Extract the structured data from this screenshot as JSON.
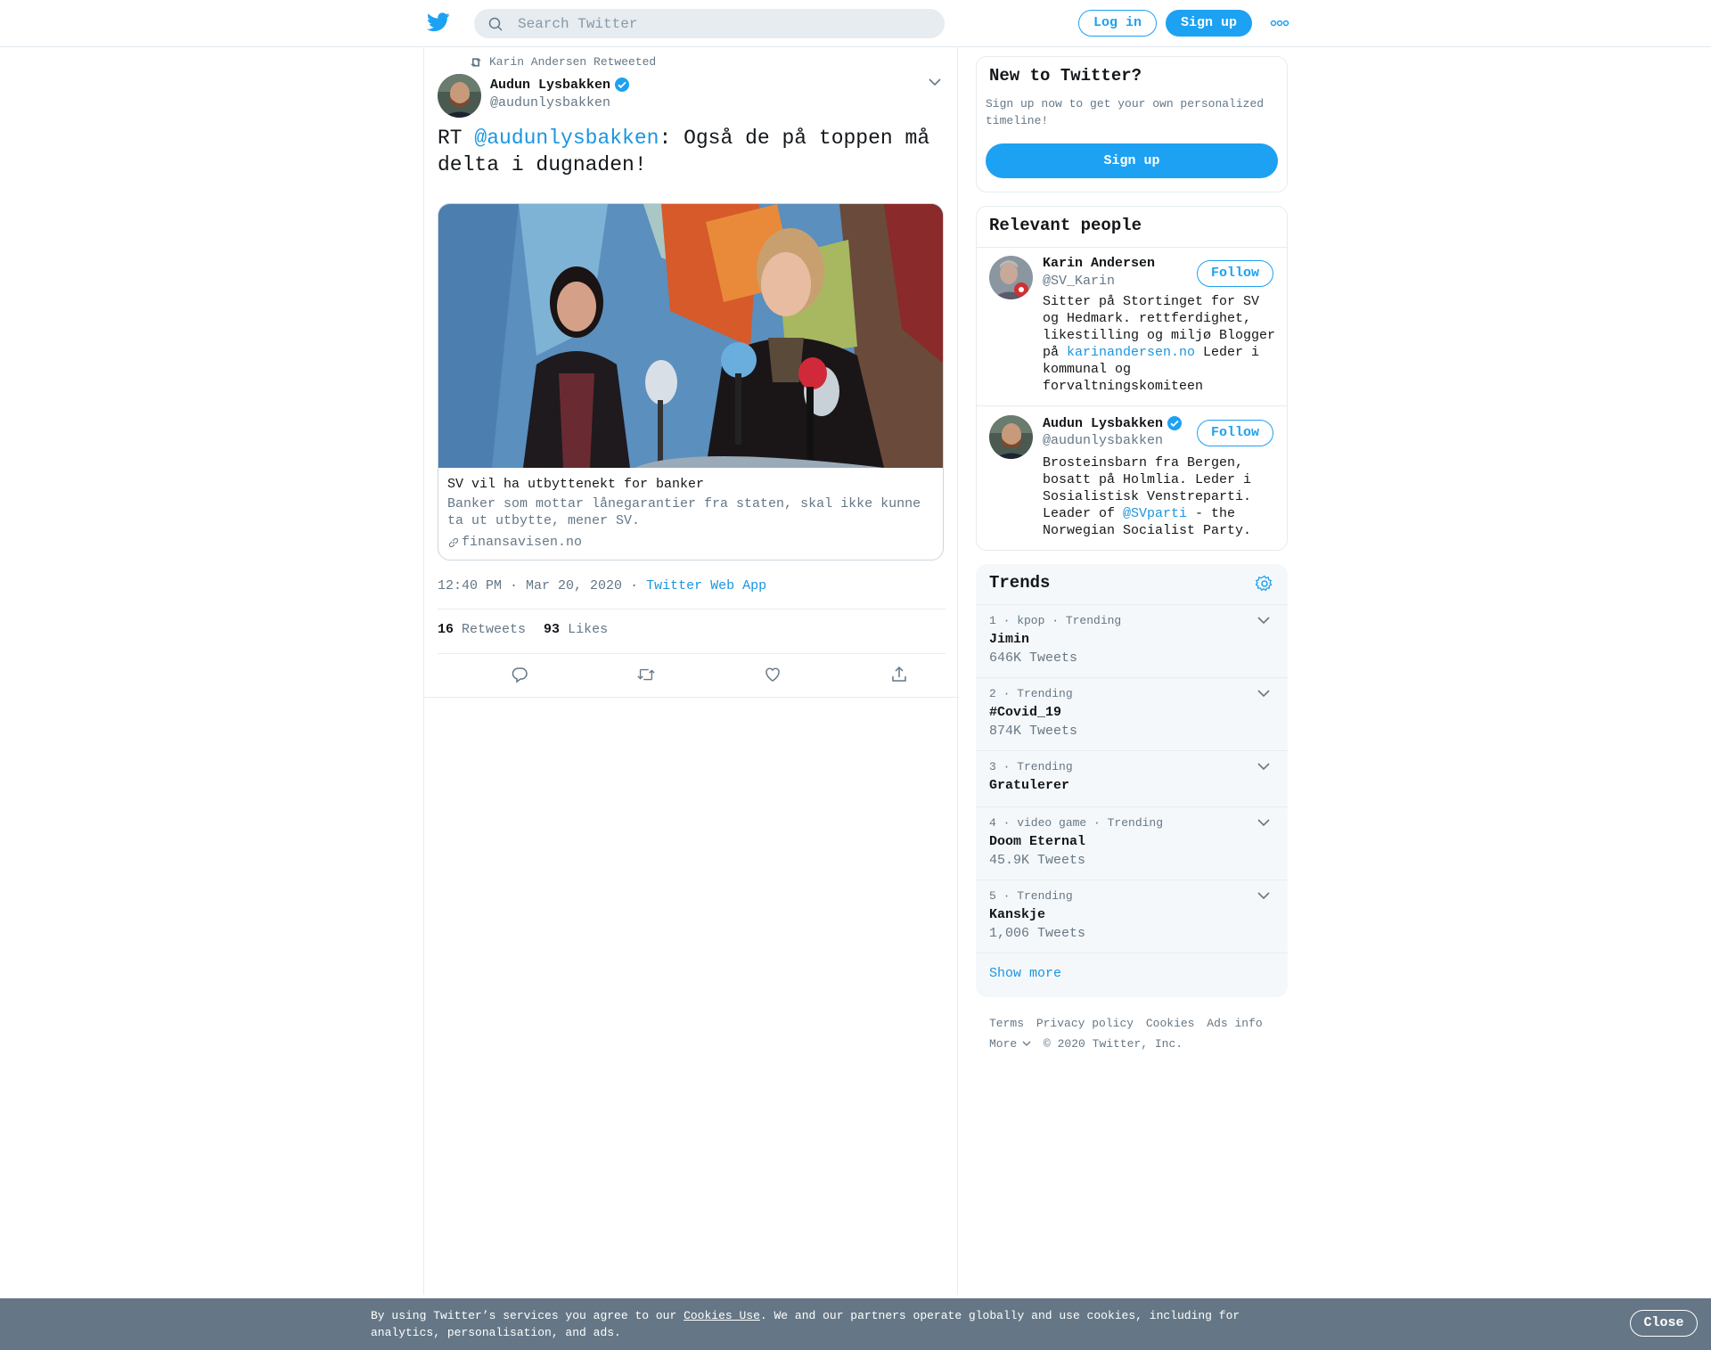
{
  "header": {
    "search_placeholder": "Search Twitter",
    "login_label": "Log in",
    "signup_label": "Sign up"
  },
  "tweet": {
    "retweeted_by": "Karin Andersen Retweeted",
    "author_name": "Audun Lysbakken",
    "author_handle": "@audunlysbakken",
    "text_prefix": "RT ",
    "text_mention": "@audunlysbakken",
    "text_rest": ": Også de på toppen må delta i dugnaden!",
    "card": {
      "title": "SV vil ha utbyttenekt for banker",
      "description": "Banker som mottar lånegarantier fra staten, skal ikke kunne ta ut utbytte, mener SV.",
      "domain": "finansavisen.no"
    },
    "time": "12:40 PM · Mar 20, 2020",
    "separator": "·",
    "source": "Twitter Web App",
    "retweets_count": "16",
    "retweets_label": "Retweets",
    "likes_count": "93",
    "likes_label": "Likes"
  },
  "new_to_twitter": {
    "title": "New to Twitter?",
    "text": "Sign up now to get your own personalized timeline!",
    "button": "Sign up"
  },
  "relevant_people": {
    "title": "Relevant people",
    "people": [
      {
        "name": "Karin Andersen",
        "handle": "@SV_Karin",
        "follow": "Follow",
        "bio_1": "Sitter på Stortinget for SV og Hedmark. rettferdighet, likestilling og miljø Blogger på ",
        "bio_link": "karinandersen.no",
        "bio_2": " Leder i kommunal og forvaltningskomiteen"
      },
      {
        "name": "Audun Lysbakken",
        "handle": "@audunlysbakken",
        "follow": "Follow",
        "bio_1": "Brosteinsbarn fra Bergen, bosatt på Holmlia. Leder i Sosialistisk Venstreparti. Leader of ",
        "bio_link": "@SVparti",
        "bio_2": " - the Norwegian Socialist Party."
      }
    ]
  },
  "trends": {
    "title": "Trends",
    "items": [
      {
        "context": "1 · kpop · Trending",
        "name": "Jimin",
        "count": "646K Tweets"
      },
      {
        "context": "2 · Trending",
        "name": "#Covid_19",
        "count": "874K Tweets"
      },
      {
        "context": "3 · Trending",
        "name": "Gratulerer",
        "count": ""
      },
      {
        "context": "4 · video game · Trending",
        "name": "Doom Eternal",
        "count": "45.9K Tweets"
      },
      {
        "context": "5 · Trending",
        "name": "Kanskje",
        "count": "1,006 Tweets"
      }
    ],
    "show_more": "Show more"
  },
  "footer": {
    "terms": "Terms",
    "privacy": "Privacy policy",
    "cookies": "Cookies",
    "ads": "Ads info",
    "more": "More",
    "copyright": "© 2020 Twitter, Inc."
  },
  "cookie_banner": {
    "text_1": "By using Twitter’s services you agree to our ",
    "link": "Cookies Use",
    "text_2": ". We and our partners operate globally and use cookies, including for analytics, personalisation, and ads.",
    "close": "Close"
  },
  "colors": {
    "brand": "#1da1f2",
    "link": "#1b95e0",
    "secondary_text": "#657786",
    "banner_bg": "#657786"
  }
}
